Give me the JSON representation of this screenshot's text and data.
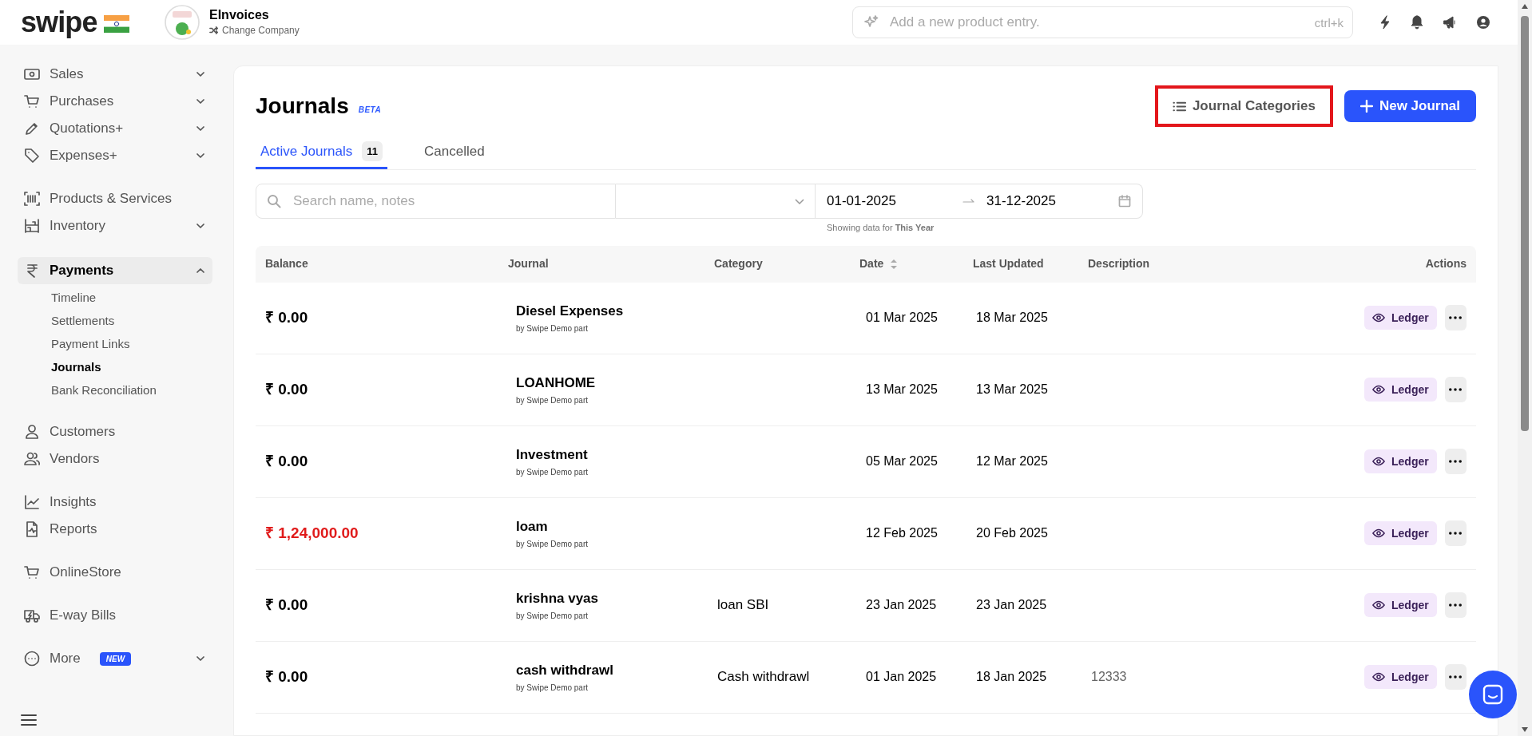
{
  "brand": {
    "name": "swipe"
  },
  "company": {
    "name": "EInvoices",
    "switch_label": "Change Company"
  },
  "search": {
    "placeholder": "Add a new product entry.",
    "shortcut": "ctrl+k"
  },
  "sidebar": {
    "groups": [
      {
        "items": [
          {
            "label": "Sales",
            "expanded": false,
            "selected": false
          },
          {
            "label": "Purchases",
            "expanded": false,
            "selected": false
          },
          {
            "label": "Quotations+",
            "expanded": false,
            "selected": false
          },
          {
            "label": "Expenses+",
            "expanded": false,
            "selected": false
          }
        ]
      },
      {
        "items": [
          {
            "label": "Products & Services",
            "selected": false
          },
          {
            "label": "Inventory",
            "expanded": false,
            "selected": false
          }
        ]
      },
      {
        "items": [
          {
            "label": "Payments",
            "expanded": true,
            "selected": true,
            "children": [
              {
                "label": "Timeline",
                "selected": false
              },
              {
                "label": "Settlements",
                "selected": false
              },
              {
                "label": "Payment Links",
                "selected": false
              },
              {
                "label": "Journals",
                "selected": true
              },
              {
                "label": "Bank Reconciliation",
                "selected": false
              }
            ]
          }
        ]
      },
      {
        "items": [
          {
            "label": "Customers",
            "selected": false
          },
          {
            "label": "Vendors",
            "selected": false
          }
        ]
      },
      {
        "items": [
          {
            "label": "Insights",
            "selected": false
          },
          {
            "label": "Reports",
            "selected": false
          }
        ]
      },
      {
        "items": [
          {
            "label": "OnlineStore",
            "selected": false
          }
        ]
      },
      {
        "items": [
          {
            "label": "E-way Bills",
            "selected": false
          }
        ]
      },
      {
        "items": [
          {
            "label": "More",
            "badge": "NEW",
            "expanded": false,
            "selected": false
          }
        ]
      }
    ]
  },
  "page": {
    "title": "Journals",
    "badge": "BETA",
    "categories_button": "Journal Categories",
    "new_button": "New Journal"
  },
  "tabs": [
    {
      "label": "Active Journals",
      "count": "11",
      "selected": true
    },
    {
      "label": "Cancelled",
      "selected": false
    }
  ],
  "filters": {
    "search_placeholder": "Search name, notes",
    "date_from": "01-01-2025",
    "date_to": "31-12-2025",
    "hint": "Showing data for **This Year**"
  },
  "table": {
    "columns": [
      "Balance",
      "Journal",
      "Category",
      "Date",
      "Last Updated",
      "Description",
      "Actions"
    ],
    "rows": [
      {
        "balance": "₹ 0.00",
        "negative": false,
        "journal": "Diesel Expenses",
        "by": "by Swipe Demo part",
        "date": "01 Mar 2025",
        "updated": "18 Mar 2025",
        "action": "Ledger"
      },
      {
        "balance": "₹ 0.00",
        "negative": false,
        "journal": "LOANHOME",
        "by": "by Swipe Demo part",
        "date": "13 Mar 2025",
        "updated": "13 Mar 2025",
        "action": "Ledger"
      },
      {
        "balance": "₹ 0.00",
        "negative": false,
        "journal": "Investment",
        "by": "by Swipe Demo part",
        "date": "05 Mar 2025",
        "updated": "12 Mar 2025",
        "action": "Ledger"
      },
      {
        "balance": "₹ 1,24,000.00",
        "negative": true,
        "journal": "loam",
        "by": "by Swipe Demo part",
        "date": "12 Feb 2025",
        "updated": "20 Feb 2025",
        "action": "Ledger"
      },
      {
        "balance": "₹ 0.00",
        "negative": false,
        "journal": "krishna vyas",
        "by": "by Swipe Demo part",
        "category": "loan SBI",
        "date": "23 Jan 2025",
        "updated": "23 Jan 2025",
        "action": "Ledger"
      },
      {
        "balance": "₹ 0.00",
        "negative": false,
        "journal": "cash withdrawl",
        "by": "by Swipe Demo part",
        "category": "Cash withdrawl",
        "date": "01 Jan 2025",
        "updated": "18 Jan 2025",
        "description": "12333",
        "action": "Ledger"
      }
    ]
  }
}
